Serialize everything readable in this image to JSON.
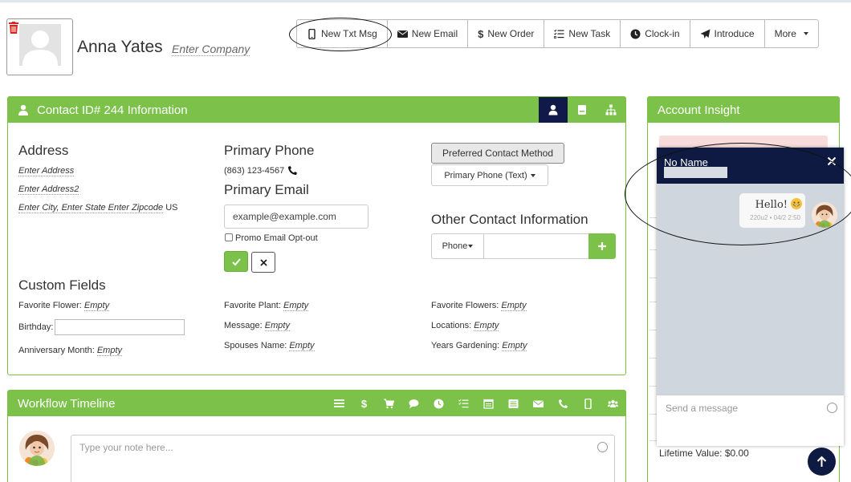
{
  "contact": {
    "name": "Anna Yates",
    "company_placeholder": "Enter Company"
  },
  "toolbar": {
    "items": [
      {
        "label": "New Txt Msg",
        "icon": "mobile-icon"
      },
      {
        "label": "New Email",
        "icon": "envelope-icon"
      },
      {
        "label": "New Order",
        "icon": "dollar-icon"
      },
      {
        "label": "New Task",
        "icon": "tasks-icon"
      },
      {
        "label": "Clock-in",
        "icon": "clock-icon"
      },
      {
        "label": "Introduce",
        "icon": "paper-plane-icon"
      },
      {
        "label": "More",
        "icon": "caret-down-icon"
      }
    ]
  },
  "info_panel": {
    "title": "Contact ID# 244 Information",
    "address": {
      "heading": "Address",
      "line1": "Enter Address",
      "line2": "Enter Address2",
      "city_state_zip": "Enter City, Enter State Enter Zipcode",
      "country": "US"
    },
    "primary_phone": {
      "heading": "Primary Phone",
      "value": "(863) 123-4567"
    },
    "primary_email": {
      "heading": "Primary Email",
      "value": "example@example.com",
      "opt_out_label": "Promo Email Opt-out"
    },
    "preferred_contact": {
      "button_label": "Preferred Contact Method",
      "selected": "Primary Phone (Text)"
    },
    "other_contact": {
      "heading": "Other Contact Information",
      "type_selected": "Phone"
    },
    "custom_fields": {
      "heading": "Custom Fields",
      "col1": [
        {
          "label": "Favorite Flower:",
          "value": "Empty"
        },
        {
          "label": "Birthday:",
          "value": ""
        },
        {
          "label": "Anniversary Month:",
          "value": "Empty"
        }
      ],
      "col2": [
        {
          "label": "Favorite Plant:",
          "value": "Empty"
        },
        {
          "label": "Message:",
          "value": "Empty"
        },
        {
          "label": "Spouses Name:",
          "value": "Empty"
        }
      ],
      "col3": [
        {
          "label": "Favorite Flowers:",
          "value": "Empty"
        },
        {
          "label": "Locations:",
          "value": "Empty"
        },
        {
          "label": "Years Gardening:",
          "value": "Empty"
        }
      ]
    }
  },
  "workflow": {
    "title": "Workflow Timeline",
    "note_placeholder": "Type your note here..."
  },
  "account_insight": {
    "title": "Account Insight",
    "lifetime_value": "Lifetime Value: $0.00"
  },
  "chat": {
    "title": "No Name",
    "message_text": "Hello!",
    "message_meta": "220u2 • 04/2 2:50",
    "input_placeholder": "Send a message"
  },
  "colors": {
    "green": "#7cc24a",
    "navy": "#0e1a42",
    "delete_red": "#d9261c"
  }
}
